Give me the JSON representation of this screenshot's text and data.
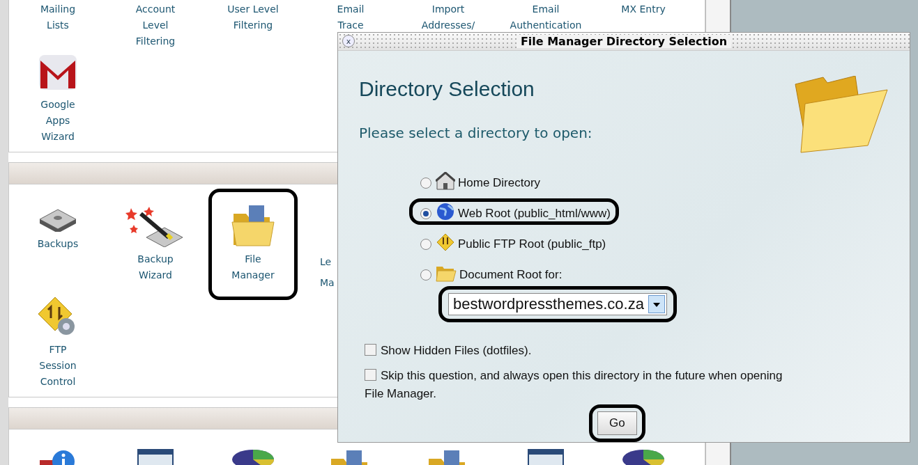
{
  "sections": [
    {
      "kind": "continued",
      "rows": [
        [
          {
            "kind": "text",
            "lines": [
              "Mailing",
              "Lists"
            ],
            "highlighted": false
          },
          {
            "kind": "text",
            "lines": [
              "Account",
              "Level",
              "Filtering"
            ],
            "highlighted": false
          },
          {
            "kind": "text",
            "lines": [
              "User Level",
              "Filtering"
            ],
            "highlighted": false
          },
          {
            "kind": "text",
            "lines": [
              "Email",
              "Trace"
            ],
            "highlighted": false
          },
          {
            "kind": "text",
            "lines": [
              "Import",
              "Addresses/"
            ],
            "highlighted": false
          },
          {
            "kind": "text",
            "lines": [
              "Email",
              "Authentication"
            ],
            "highlighted": false
          },
          {
            "kind": "text",
            "lines": [
              "MX Entry"
            ],
            "highlighted": false
          }
        ],
        [
          {
            "kind": "gmail",
            "lines": [
              "Google",
              "Apps",
              "Wizard"
            ],
            "highlighted": false
          }
        ]
      ]
    },
    {
      "kind": "titled",
      "rows": [
        [
          {
            "kind": "disk",
            "lines": [
              "Backups"
            ],
            "highlighted": false
          },
          {
            "kind": "wand",
            "lines": [
              "Backup",
              "Wizard"
            ],
            "highlighted": false
          },
          {
            "kind": "folder",
            "lines": [
              "File",
              "Manager"
            ],
            "highlighted": true
          },
          {
            "kind": "cut",
            "lines": [
              "Le",
              "Ma"
            ],
            "highlighted": false
          }
        ],
        [
          {
            "kind": "ftp",
            "lines": [
              "FTP",
              "Session",
              "Control"
            ],
            "highlighted": false
          }
        ]
      ]
    },
    {
      "kind": "titled",
      "rows": [
        [
          {
            "kind": "info"
          },
          {
            "kind": "chart"
          },
          {
            "kind": "pie"
          },
          {
            "kind": "folder"
          },
          {
            "kind": "folder"
          },
          {
            "kind": "chart"
          },
          {
            "kind": "pie"
          }
        ]
      ]
    }
  ],
  "dialog": {
    "close_label": "x",
    "title": "File Manager Directory Selection",
    "heading": "Directory Selection",
    "prompt": "Please select a directory to open:",
    "options": [
      {
        "kind": "home",
        "label": "Home Directory",
        "selected": false,
        "highlighted": false
      },
      {
        "kind": "web",
        "label": "Web Root (public_html/www)",
        "selected": true,
        "highlighted": true
      },
      {
        "kind": "ftp",
        "label": "Public FTP Root (public_ftp)",
        "selected": false,
        "highlighted": false
      },
      {
        "kind": "document",
        "label": "Document Root for:",
        "selected": false,
        "highlighted": false
      }
    ],
    "domain_select": {
      "value": "bestwordpressthemes.co.za",
      "highlighted": true
    },
    "checkboxes": [
      {
        "label": "Show Hidden Files (dotfiles).",
        "checked": false
      },
      {
        "label": "Skip this question, and always open this directory in the future when opening File Manager.",
        "checked": false
      }
    ],
    "go_button": {
      "label": "Go",
      "highlighted": true
    }
  }
}
